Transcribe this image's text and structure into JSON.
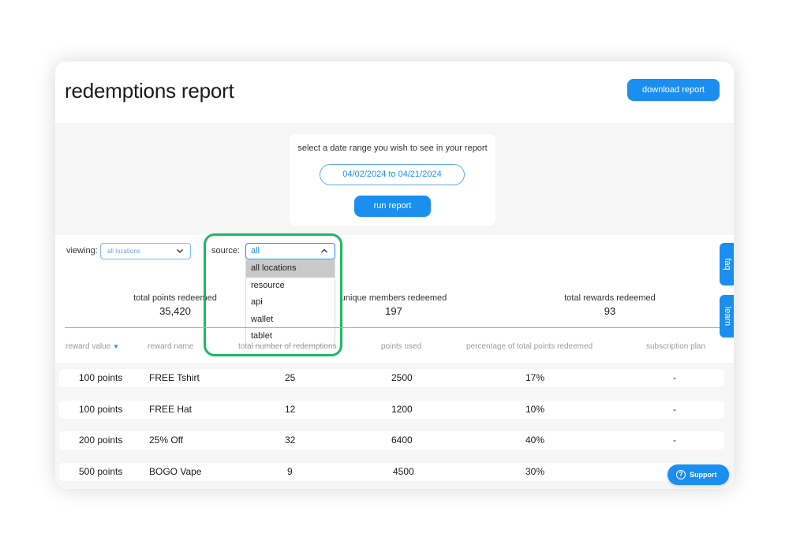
{
  "header": {
    "title": "redemptions report",
    "download_label": "download report"
  },
  "date_range": {
    "prompt": "select a date range you wish to see in your report",
    "value": "04/02/2024 to 04/21/2024",
    "run_label": "run report"
  },
  "filters": {
    "viewing_label": "viewing:",
    "viewing_value": "all locations",
    "source_label": "source:",
    "source_value": "all",
    "source_options": [
      "all locations",
      "resource",
      "api",
      "wallet",
      "tablet"
    ],
    "source_selected_option": "all locations"
  },
  "stats": [
    {
      "label": "total points redeemed",
      "value": "35,420"
    },
    {
      "label": "unique members redeemed",
      "value": "197"
    },
    {
      "label": "total rewards redeemed",
      "value": "93"
    }
  ],
  "side_tabs": [
    "faq",
    "learn"
  ],
  "table": {
    "columns": [
      "reward value",
      "reward name",
      "total number of redemptions",
      "points used",
      "percentage of total points redeemed",
      "subscription plan"
    ],
    "sort_indicator": "▼",
    "rows": [
      {
        "value": "100 points",
        "name": "FREE Tshirt",
        "redemptions": "25",
        "points": "2500",
        "pct": "17%",
        "plan": "-"
      },
      {
        "value": "100 points",
        "name": "FREE Hat",
        "redemptions": "12",
        "points": "1200",
        "pct": "10%",
        "plan": "-"
      },
      {
        "value": "200 points",
        "name": "25% Off",
        "redemptions": "32",
        "points": "6400",
        "pct": "40%",
        "plan": "-"
      },
      {
        "value": "500 points",
        "name": "BOGO Vape",
        "redemptions": "9",
        "points": "4500",
        "pct": "30%",
        "plan": ""
      }
    ]
  },
  "support": {
    "label": "Support",
    "icon": "help-circle-icon"
  },
  "colors": {
    "accent": "#1a8ff0",
    "highlight": "#1fb66a"
  }
}
